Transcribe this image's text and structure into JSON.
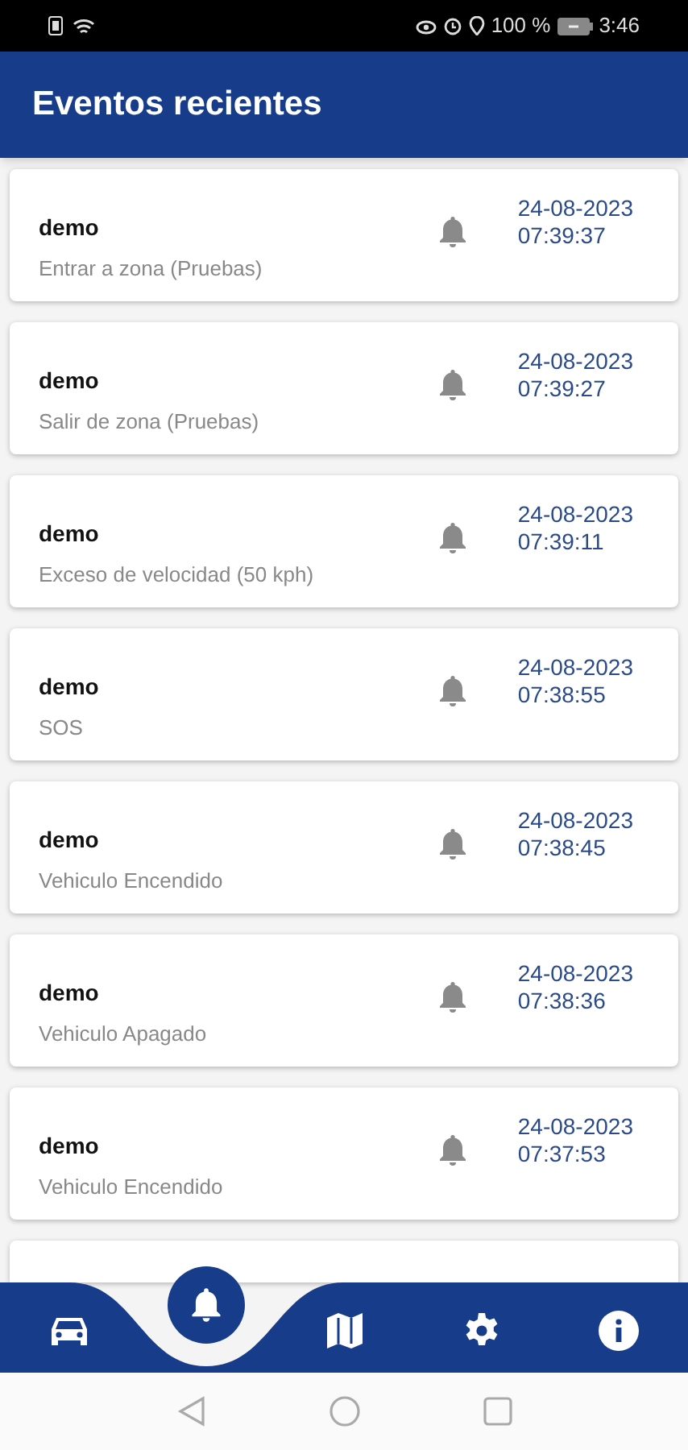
{
  "status_bar": {
    "battery": "100 %",
    "time": "3:46"
  },
  "header": {
    "title": "Eventos recientes"
  },
  "events": [
    {
      "device": "demo",
      "description": "Entrar a zona (Pruebas)",
      "date": "24-08-2023",
      "time": "07:39:37"
    },
    {
      "device": "demo",
      "description": "Salir de zona (Pruebas)",
      "date": "24-08-2023",
      "time": "07:39:27"
    },
    {
      "device": "demo",
      "description": "Exceso de velocidad (50 kph)",
      "date": "24-08-2023",
      "time": "07:39:11"
    },
    {
      "device": "demo",
      "description": "SOS",
      "date": "24-08-2023",
      "time": "07:38:55"
    },
    {
      "device": "demo",
      "description": "Vehiculo Encendido",
      "date": "24-08-2023",
      "time": "07:38:45"
    },
    {
      "device": "demo",
      "description": "Vehiculo Apagado",
      "date": "24-08-2023",
      "time": "07:38:36"
    },
    {
      "device": "demo",
      "description": "Vehiculo Encendido",
      "date": "24-08-2023",
      "time": "07:37:53"
    }
  ],
  "bottom_nav": [
    {
      "kind": "car",
      "selected": false
    },
    {
      "kind": "bell",
      "selected": true
    },
    {
      "kind": "map",
      "selected": false
    },
    {
      "kind": "gear",
      "selected": false
    },
    {
      "kind": "info",
      "selected": false
    }
  ]
}
